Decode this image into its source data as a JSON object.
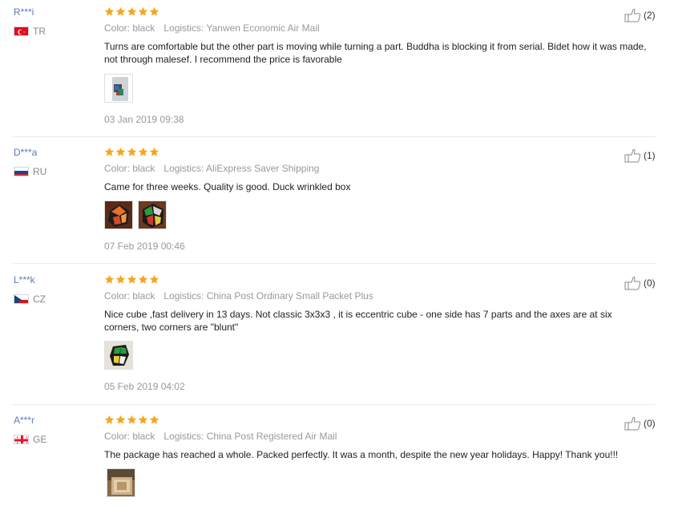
{
  "reviews": [
    {
      "user": "R***i",
      "country": "TR",
      "country_flag": "turkey-flag",
      "rating": 5,
      "color_label": "Color: black",
      "logistics_label": "Logistics: Yanwen Economic Air Mail",
      "text": "Turns are comfortable but the other part is moving while turning a part. Buddha is blocking it from serial. Bidet how it was made, not through malesef. I recommend the price is favorable",
      "helpful_count": "(2)",
      "date": "03 Jan 2019 09:38"
    },
    {
      "user": "D***a",
      "country": "RU",
      "country_flag": "russia-flag",
      "rating": 5,
      "color_label": "Color: black",
      "logistics_label": "Logistics: AliExpress Saver Shipping",
      "text": "Came for three weeks. Quality is good. Duck wrinkled box",
      "helpful_count": "(1)",
      "date": "07 Feb 2019 00:46"
    },
    {
      "user": "L***k",
      "country": "CZ",
      "country_flag": "czech-flag",
      "rating": 5,
      "color_label": "Color: black",
      "logistics_label": "Logistics: China Post Ordinary Small Packet Plus",
      "text": "Nice cube ,fast delivery in 13 days. Not classic 3x3x3 , it is eccentric cube - one side has 7 parts and the axes are at six corners, two corners are \"blunt\"",
      "helpful_count": "(0)",
      "date": "05 Feb 2019 04:02"
    },
    {
      "user": "A***r",
      "country": "GE",
      "country_flag": "georgia-flag",
      "rating": 5,
      "color_label": "Color: black",
      "logistics_label": "Logistics: China Post Registered Air Mail",
      "text": "The package has reached a whole. Packed perfectly. It was a month, despite the new year holidays. Happy! Thank you!!!",
      "helpful_count": "(0)",
      "date": ""
    }
  ],
  "colors": {
    "star": "#f5a623",
    "username": "#5b7cbb",
    "meta": "#999999"
  }
}
